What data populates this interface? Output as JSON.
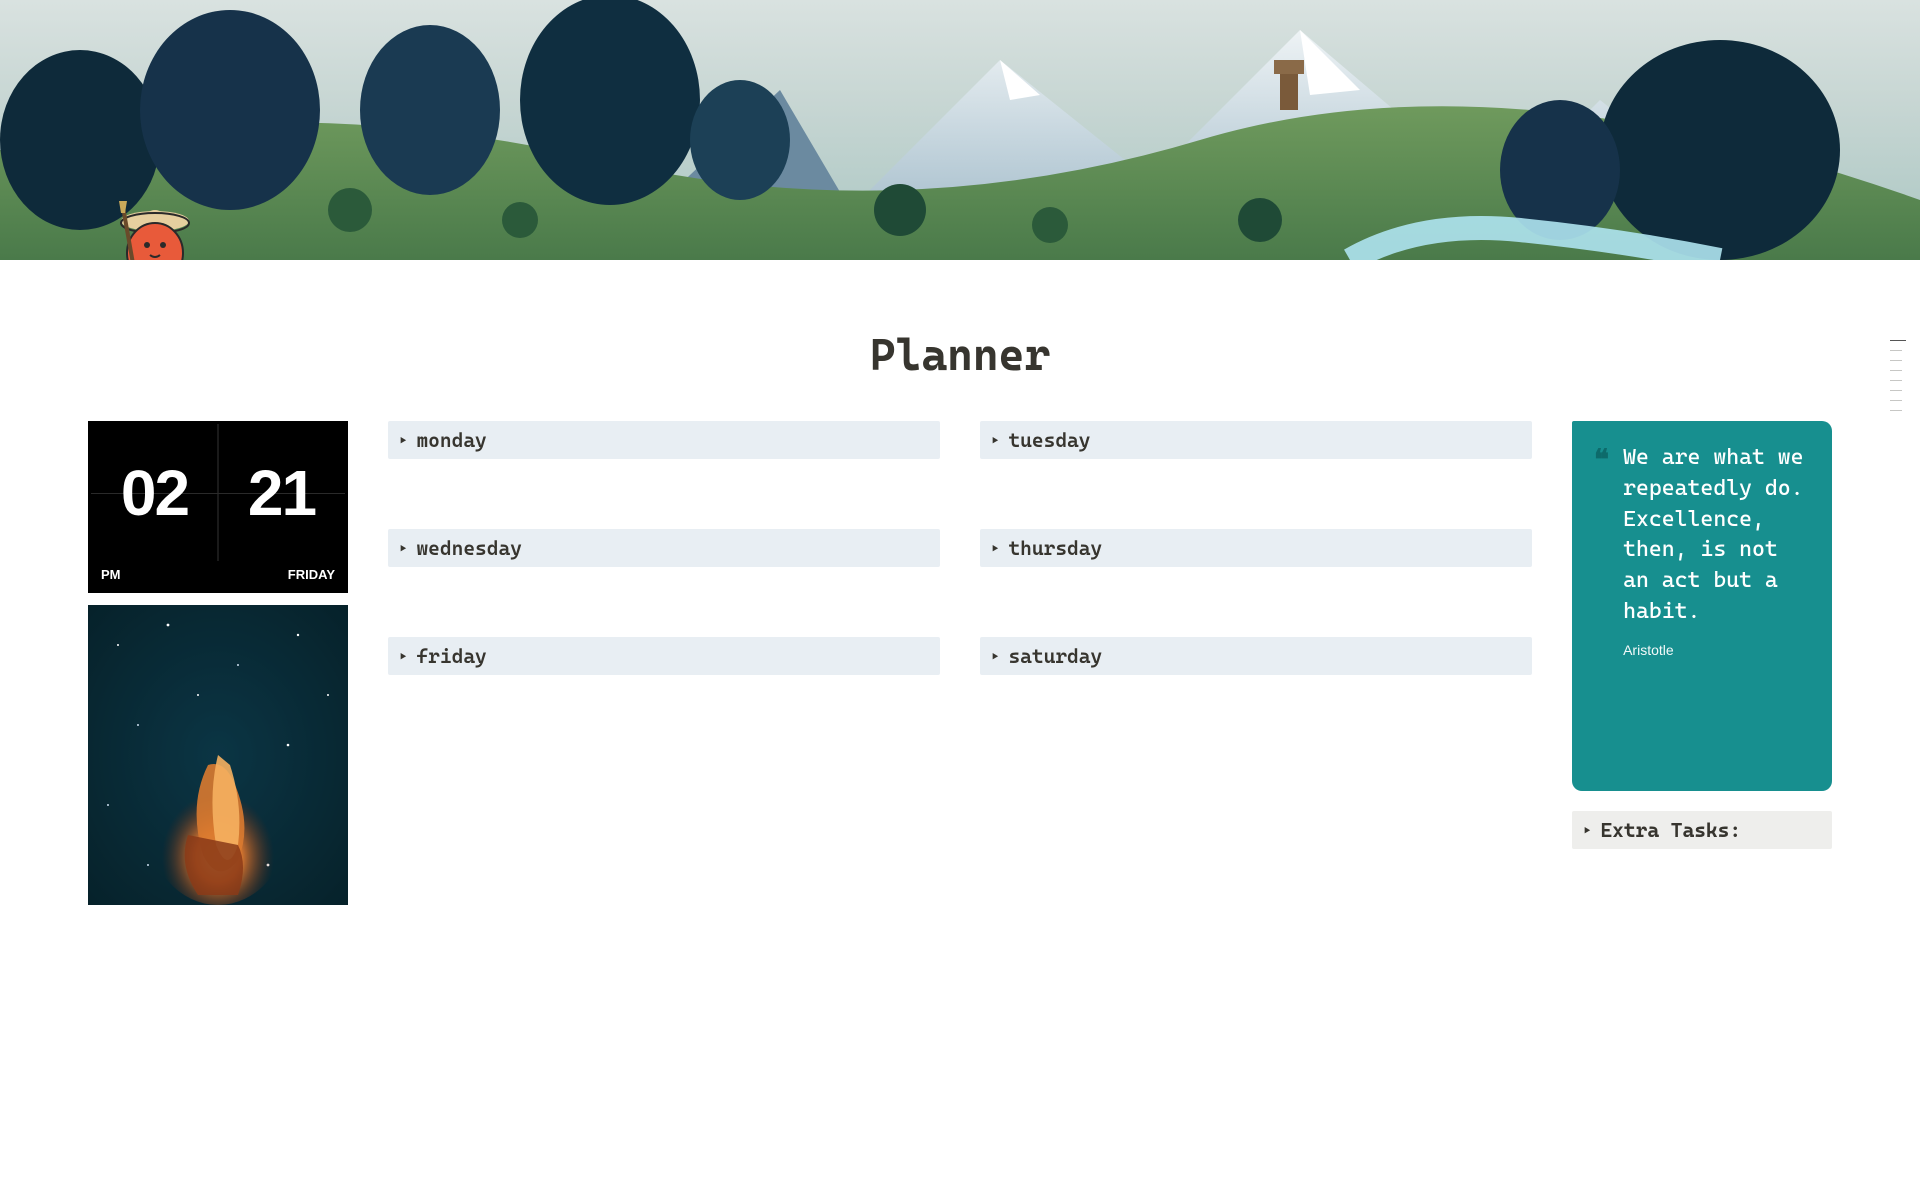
{
  "page": {
    "title": "Planner"
  },
  "clock": {
    "hours": "02",
    "minutes": "21",
    "ampm": "PM",
    "day": "FRIDAY"
  },
  "days": {
    "mon": "monday",
    "tue": "tuesday",
    "wed": "wednesday",
    "thu": "thursday",
    "fri": "friday",
    "sat": "saturday"
  },
  "quote": {
    "text": "We are what we repeatedly do. Excellence, then, is not an act but a habit.",
    "author": "Aristotle"
  },
  "extra": {
    "label": "Extra Tasks:"
  }
}
